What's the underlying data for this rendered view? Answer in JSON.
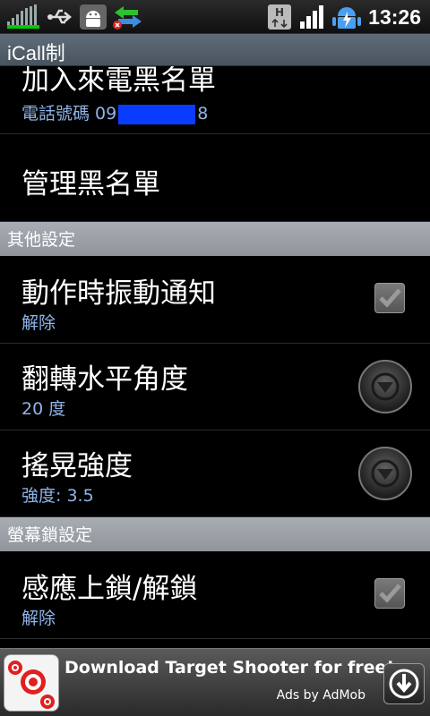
{
  "status_bar": {
    "clock": "13:26",
    "icons": [
      "signal-bars-icon",
      "usb-icon",
      "android-debug-icon",
      "sync-icon",
      "hspa-icon",
      "cell-signal-icon",
      "battery-charging-icon"
    ]
  },
  "app": {
    "title": "iCall制"
  },
  "list": {
    "item_blacklist_add": {
      "title": "加入來電黑名單",
      "summary_prefix": "電話號碼 09",
      "summary_suffix": "8"
    },
    "item_manage": {
      "title": "管理黑名單"
    },
    "category_other": {
      "label": "其他設定"
    },
    "item_vibrate": {
      "title": "動作時振動通知",
      "summary": "解除",
      "checked": true
    },
    "item_flip": {
      "title": "翻轉水平角度",
      "summary": "20 度"
    },
    "item_shake": {
      "title": "搖晃強度",
      "summary": "強度: 3.5"
    },
    "category_lock": {
      "label": "螢幕鎖設定"
    },
    "item_sense_lock": {
      "title": "感應上鎖/解鎖",
      "summary": "解除",
      "checked": true
    }
  },
  "ad": {
    "title": "Download Target Shooter for free!",
    "subtitle": "Ads by AdMob",
    "icon": "download-icon"
  },
  "colors": {
    "summary_text": "#8fb4e8",
    "title_bar": "#55616d",
    "category_bar": "#9aa0a6",
    "redaction": "#0a3cff"
  }
}
